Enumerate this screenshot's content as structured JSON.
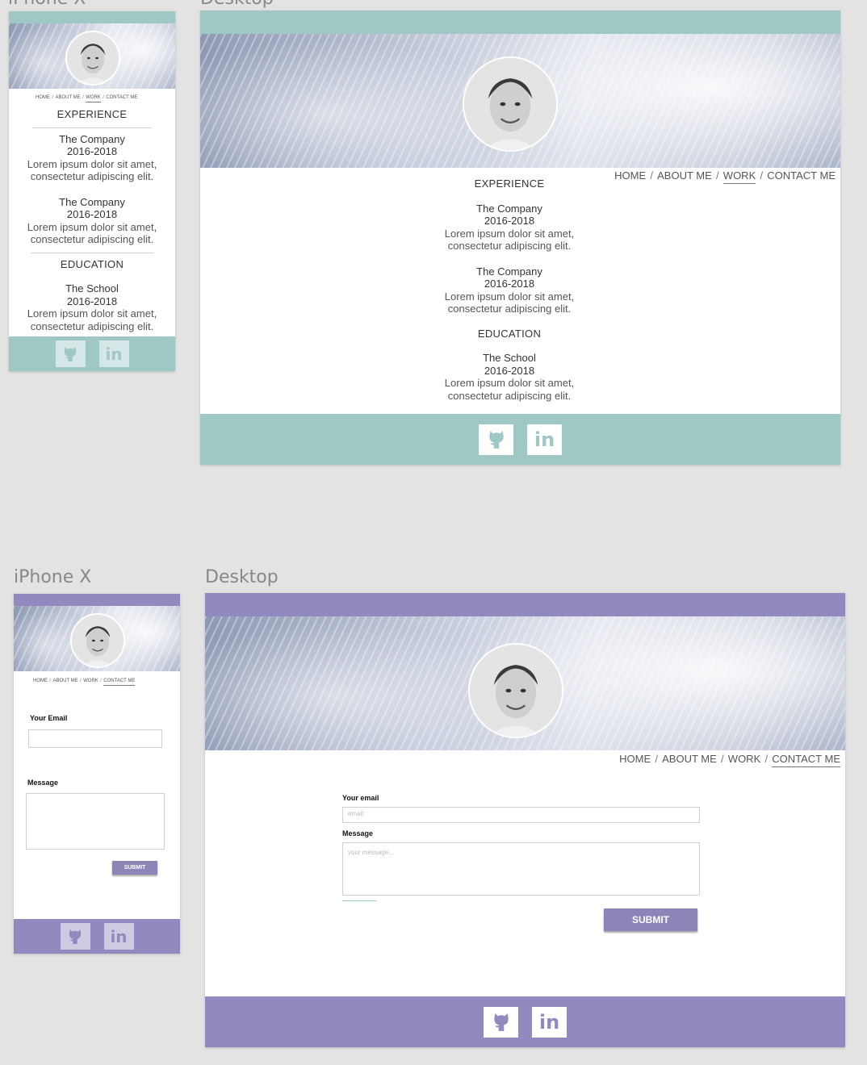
{
  "frames": {
    "mobile_label": "iPhone X",
    "desktop_label": "Desktop"
  },
  "colors": {
    "teal": "#9fc8c5",
    "purple": "#9289bf",
    "submit": "#8c86b8"
  },
  "nav": {
    "home": "HOME",
    "about": "ABOUT ME",
    "work": "WORK",
    "contact": "CONTACT ME",
    "separator": "/"
  },
  "cv": {
    "experience_heading": "EXPERIENCE",
    "education_heading": "EDUCATION",
    "jobs": [
      {
        "title": "The Company",
        "years": "2016-2018",
        "desc1": "Lorem ipsum dolor sit amet,",
        "desc2": "consectetur adipiscing elit."
      },
      {
        "title": "The Company",
        "years": "2016-2018",
        "desc1": "Lorem ipsum dolor sit amet,",
        "desc2": "consectetur adipiscing elit."
      }
    ],
    "school": {
      "title": "The School",
      "years": "2016-2018",
      "desc1": "Lorem ipsum dolor sit amet,",
      "desc2": "consectetur adipiscing elit."
    }
  },
  "contact_mobile": {
    "email_label": "Your Email",
    "message_label": "Message",
    "submit_label": "SUBMIT"
  },
  "contact_desktop": {
    "email_label": "Your email",
    "email_placeholder": "email",
    "message_label": "Message",
    "message_placeholder": "your message...",
    "submit_label": "SUBMIT"
  },
  "social": {
    "github_icon": "github-icon",
    "linkedin_icon": "linkedin-icon",
    "linkedin_text": "in"
  }
}
